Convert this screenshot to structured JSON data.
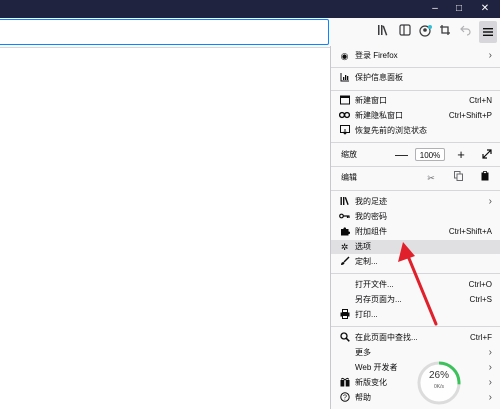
{
  "window_controls": {
    "minimize": "–",
    "maximize": "□",
    "close": "✕"
  },
  "toolbar_icons": [
    "library-icon",
    "sidebar-icon",
    "account-sync-icon",
    "screenshot-crop-icon",
    "back-arrow-icon"
  ],
  "menu": {
    "signin": "登录 Firefox",
    "protection_dashboard": "保护信息面板",
    "new_window": {
      "label": "新建窗口",
      "shortcut": "Ctrl+N"
    },
    "new_private_window": {
      "label": "新建隐私窗口",
      "shortcut": "Ctrl+Shift+P"
    },
    "restore_session": "恢复先前的浏览状态",
    "zoom": {
      "label": "缩放",
      "value": "100%",
      "minus": "—",
      "plus": "+"
    },
    "edit": "编辑",
    "library": "我的足迹",
    "logins": "我的密码",
    "addons": {
      "label": "附加组件",
      "shortcut": "Ctrl+Shift+A"
    },
    "options": "选项",
    "customize": "定制...",
    "open_file": {
      "label": "打开文件...",
      "shortcut": "Ctrl+O"
    },
    "save_page": {
      "label": "另存页面为...",
      "shortcut": "Ctrl+S"
    },
    "print": "打印...",
    "find": {
      "label": "在此页面中查找...",
      "shortcut": "Ctrl+F"
    },
    "more": "更多",
    "web_developer": "Web 开发者",
    "whats_new": "新版变化",
    "help": "帮助"
  },
  "overlay": {
    "progress_percent": 26,
    "progress_label": "26%",
    "progress_sublabel": "0K/s"
  },
  "colors": {
    "titlebar": "#202340",
    "menu_bg": "#f9f9fa",
    "highlight": "#e0e0e2",
    "arrow": "#e0202a",
    "progress": "#3cc25a"
  }
}
